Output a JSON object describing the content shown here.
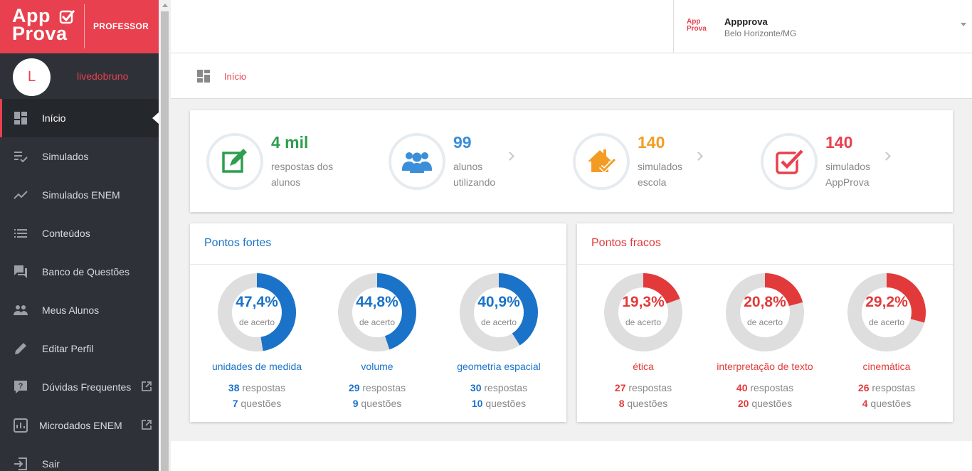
{
  "brand": {
    "logo_line1": "App",
    "logo_line2": "Prova",
    "role": "PROFESSOR",
    "accent": "#e8404e"
  },
  "user": {
    "initial": "L",
    "name": "livedobruno"
  },
  "nav": [
    {
      "label": "Início",
      "icon": "dashboard-icon",
      "active": true
    },
    {
      "label": "Simulados",
      "icon": "playlist-check-icon"
    },
    {
      "label": "Simulados ENEM",
      "icon": "trending-up-icon"
    },
    {
      "label": "Conteúdos",
      "icon": "list-icon"
    },
    {
      "label": "Banco de Questões",
      "icon": "forum-icon"
    },
    {
      "label": "Meus Alunos",
      "icon": "people-icon"
    },
    {
      "label": "Editar Perfil",
      "icon": "pencil-icon"
    },
    {
      "label": "Dúvidas Frequentes",
      "icon": "help-icon",
      "external": true
    },
    {
      "label": "Microdados ENEM",
      "icon": "chart-icon",
      "external": true
    },
    {
      "label": "Sair",
      "icon": "exit-icon"
    }
  ],
  "school": {
    "logo_text": "App Prova",
    "name": "Appprova",
    "city": "Belo Horizonte/MG"
  },
  "breadcrumb": {
    "label": "Início"
  },
  "stats": [
    {
      "value": "4 mil",
      "label": "respostas dos alunos",
      "color": "#2e9e4f",
      "icon": "edit-note-icon"
    },
    {
      "value": "99",
      "label": "alunos utilizando",
      "color": "#3a8fd8",
      "icon": "users-icon"
    },
    {
      "value": "140",
      "label": "simulados escola",
      "color": "#f39c24",
      "icon": "school-check-icon"
    },
    {
      "value": "140",
      "label": "simulados AppProva",
      "color": "#e8404e",
      "icon": "appprova-check-icon"
    }
  ],
  "strong": {
    "title": "Pontos fortes",
    "color": "#1a73c8",
    "topics": [
      {
        "percent": "47,4%",
        "fraction": 0.474,
        "caption": "de acerto",
        "name": "unidades de medida",
        "responses": "38",
        "responses_label": "respostas",
        "questions": "7",
        "questions_label": "questões"
      },
      {
        "percent": "44,8%",
        "fraction": 0.448,
        "caption": "de acerto",
        "name": "volume",
        "responses": "29",
        "responses_label": "respostas",
        "questions": "9",
        "questions_label": "questões"
      },
      {
        "percent": "40,9%",
        "fraction": 0.409,
        "caption": "de acerto",
        "name": "geometria espacial",
        "responses": "30",
        "responses_label": "respostas",
        "questions": "10",
        "questions_label": "questões"
      }
    ]
  },
  "weak": {
    "title": "Pontos fracos",
    "color": "#e23a3a",
    "topics": [
      {
        "percent": "19,3%",
        "fraction": 0.193,
        "caption": "de acerto",
        "name": "ética",
        "responses": "27",
        "responses_label": "respostas",
        "questions": "8",
        "questions_label": "questões"
      },
      {
        "percent": "20,8%",
        "fraction": 0.208,
        "caption": "de acerto",
        "name": "interpretação de texto",
        "responses": "40",
        "responses_label": "respostas",
        "questions": "20",
        "questions_label": "questões"
      },
      {
        "percent": "29,2%",
        "fraction": 0.292,
        "caption": "de acerto",
        "name": "cinemática",
        "responses": "26",
        "responses_label": "respostas",
        "questions": "4",
        "questions_label": "questões"
      }
    ]
  }
}
